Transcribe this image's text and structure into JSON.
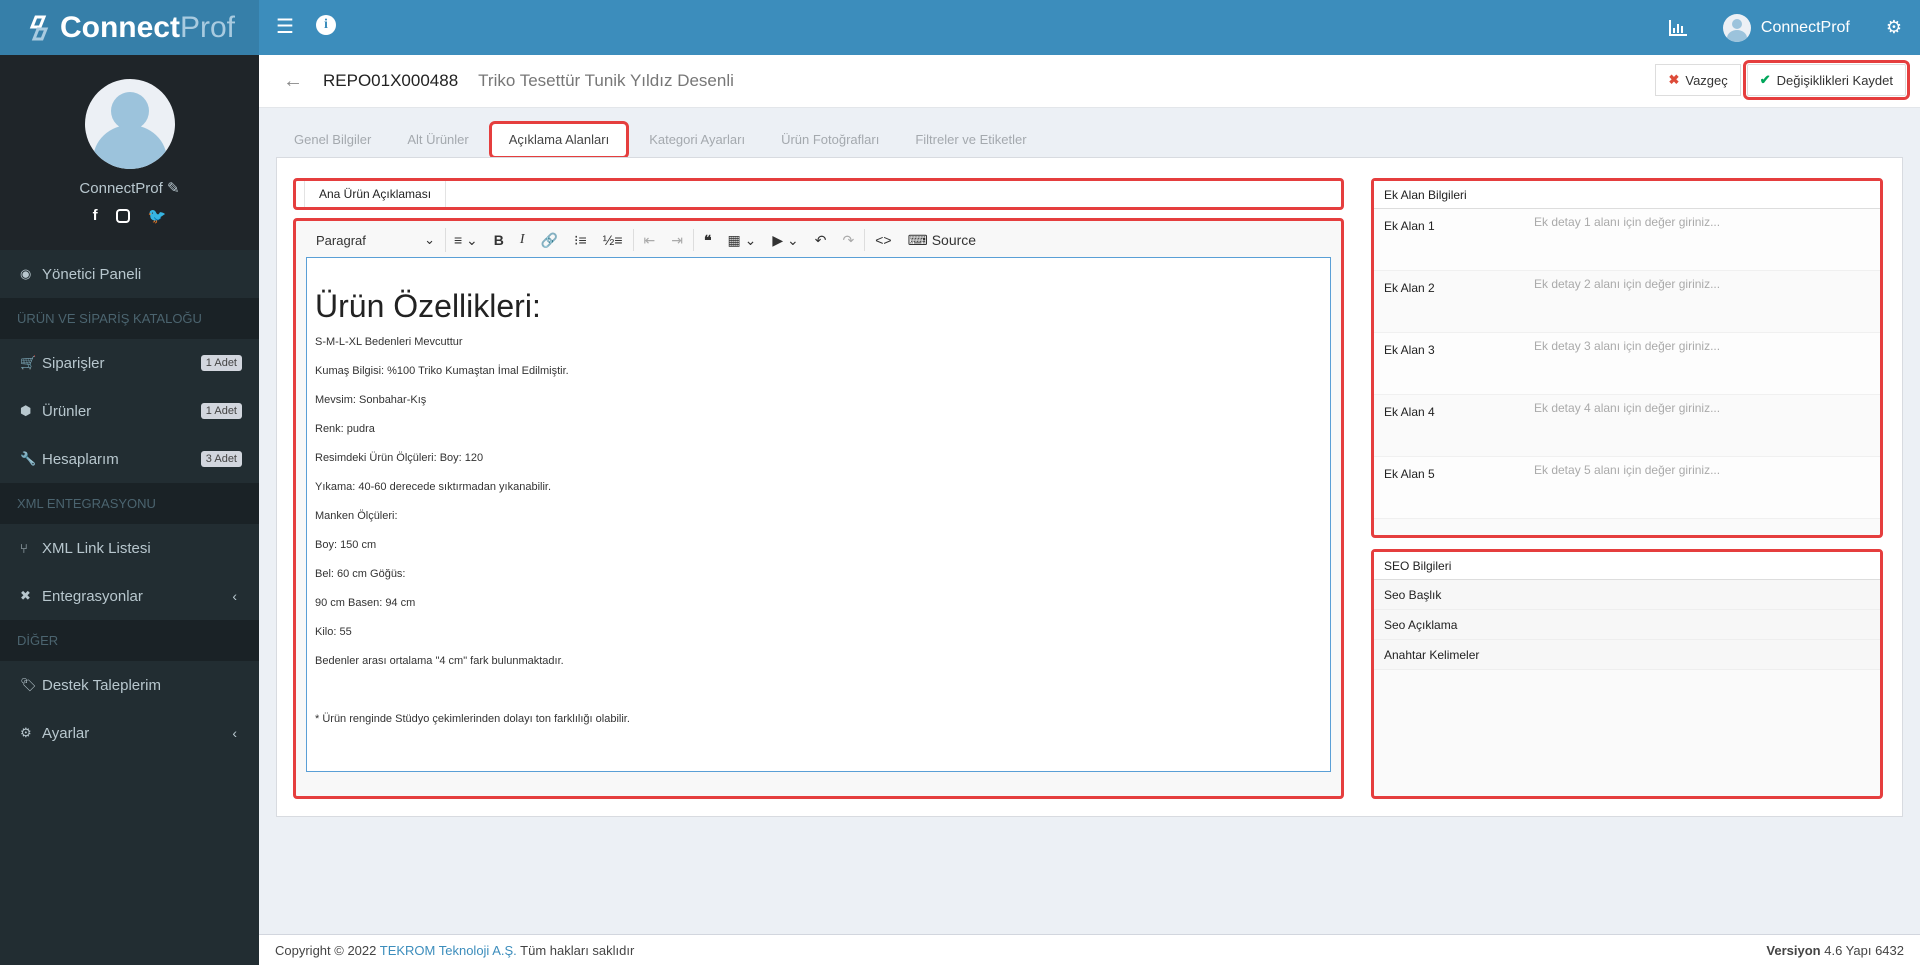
{
  "header": {
    "brand_bold": "Connect",
    "brand_light": "Prof",
    "user_name": "ConnectProf",
    "icons": [
      "menu-toggle-icon",
      "info-icon",
      "bar-chart-icon",
      "user-avatar",
      "settings-gears-icon"
    ]
  },
  "sidebar": {
    "user_name": "ConnectProf",
    "socials": [
      "facebook",
      "instagram",
      "twitter"
    ],
    "dashboard": "Yönetici Paneli",
    "section_catalog": "ÜRÜN VE SİPARİŞ KATALOĞU",
    "catalog_items": [
      {
        "label": "Siparişler",
        "badge": "1 Adet",
        "icon": "cart-icon"
      },
      {
        "label": "Ürünler",
        "badge": "1 Adet",
        "icon": "cube-icon"
      },
      {
        "label": "Hesaplarım",
        "badge": "3 Adet",
        "icon": "wrench-icon"
      }
    ],
    "section_xml": "XML ENTEGRASYONU",
    "xml_items": [
      {
        "label": "XML Link Listesi",
        "icon": "code-fork-icon"
      },
      {
        "label": "Entegrasyonlar",
        "icon": "expand-icon",
        "chevron": "‹"
      }
    ],
    "section_other": "DİĞER",
    "other_items": [
      {
        "label": "Destek Taleplerim",
        "icon": "tags-icon"
      },
      {
        "label": "Ayarlar",
        "icon": "gear-icon",
        "chevron": "‹"
      }
    ]
  },
  "page": {
    "code": "REPO01X000488",
    "product_name": "Triko Tesettür Tunik Yıldız Desenli",
    "cancel_label": "Vazgeç",
    "save_label": "Değişiklikleri Kaydet"
  },
  "tabs": [
    {
      "label": "Genel Bilgiler",
      "active": false
    },
    {
      "label": "Alt Ürünler",
      "active": false
    },
    {
      "label": "Açıklama Alanları",
      "active": true
    },
    {
      "label": "Kategori Ayarları",
      "active": false
    },
    {
      "label": "Ürün Fotoğrafları",
      "active": false
    },
    {
      "label": "Filtreler ve Etiketler",
      "active": false
    }
  ],
  "editor": {
    "sub_tab": "Ana Ürün Açıklaması",
    "heading_select": "Paragraf",
    "source_label": "Source",
    "heading": "Ürün Özellikleri:",
    "paragraphs": [
      "S-M-L-XL Bedenleri Mevcuttur",
      "Kumaş Bilgisi:  %100 Triko Kumaştan İmal Edilmiştir.",
      "Mevsim:  Sonbahar-Kış",
      "Renk: pudra",
      "Resimdeki Ürün Ölçüleri:  Boy: 120",
      "Yıkama:  40-60 derecede sıktırmadan yıkanabilir.",
      "Manken Ölçüleri:",
      "Boy: 150 cm",
      "Bel: 60 cm Göğüs:",
      "90 cm Basen: 94 cm",
      "Kilo: 55",
      "Bedenler arası ortalama \"4 cm\" fark bulunmaktadır.",
      "",
      "* Ürün renginde Stüdyo çekimlerinden dolayı ton farklılığı olabilir."
    ]
  },
  "ek_alan": {
    "title": "Ek Alan Bilgileri",
    "rows": [
      {
        "label": "Ek Alan 1",
        "placeholder": "Ek detay 1 alanı için değer giriniz...",
        "value": ""
      },
      {
        "label": "Ek Alan 2",
        "placeholder": "Ek detay 2 alanı için değer giriniz...",
        "value": ""
      },
      {
        "label": "Ek Alan 3",
        "placeholder": "Ek detay 3 alanı için değer giriniz...",
        "value": ""
      },
      {
        "label": "Ek Alan 4",
        "placeholder": "Ek detay 4 alanı için değer giriniz...",
        "value": ""
      },
      {
        "label": "Ek Alan 5",
        "placeholder": "Ek detay 5 alanı için değer giriniz...",
        "value": ""
      }
    ]
  },
  "seo": {
    "title": "SEO Bilgileri",
    "rows": [
      "Seo Başlık",
      "Seo Açıklama",
      "Anahtar Kelimeler"
    ]
  },
  "footer": {
    "copyright_prefix": "Copyright © 2022 ",
    "company": "TEKROM Teknoloji A.Ş.",
    "rights": " Tüm hakları saklıdır",
    "version_label": "Versiyon",
    "version_value": " 4.6 Yapı 6432"
  },
  "colors": {
    "header": "#3c8dbc",
    "logo_bg": "#367fa9",
    "sidebar": "#222d32",
    "highlight": "#e53e3e"
  }
}
